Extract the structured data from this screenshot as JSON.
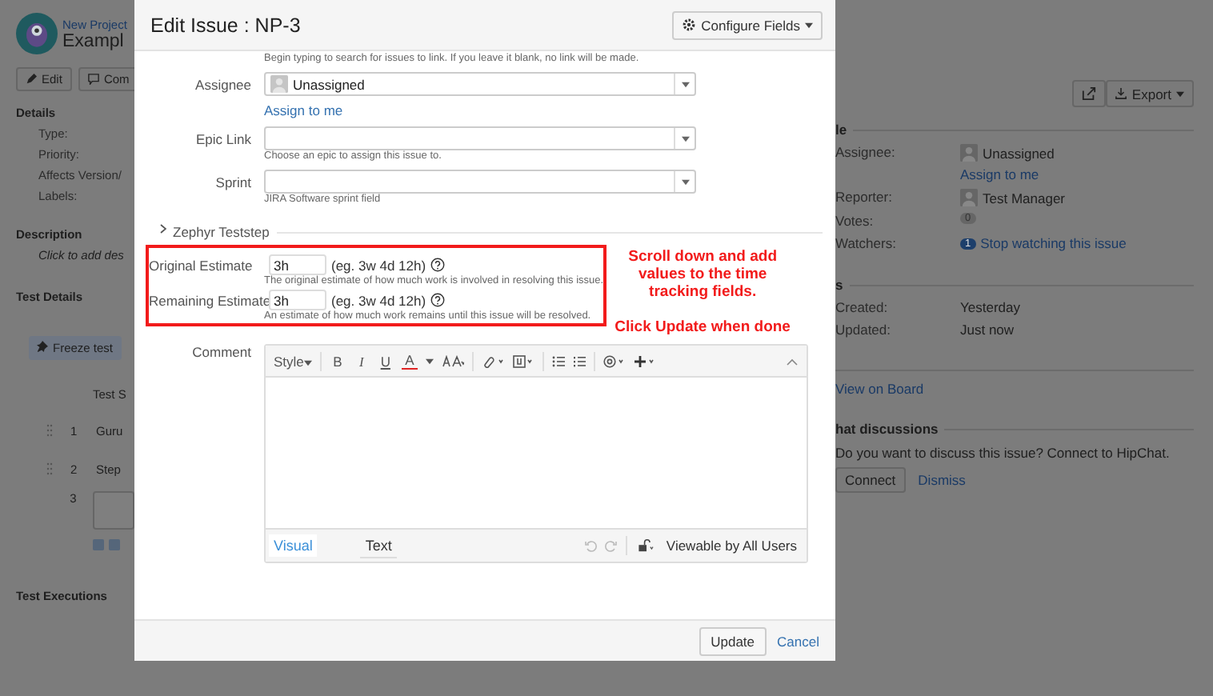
{
  "page": {
    "project": "New Project",
    "title": "Exampl",
    "actions": [
      "Edit",
      "Com"
    ],
    "details": {
      "heading": "Details",
      "fields": [
        "Type:",
        "Priority:",
        "Affects Version/",
        "Labels:"
      ]
    },
    "description": {
      "heading": "Description",
      "text": "Click to add des"
    },
    "test_details": {
      "heading": "Test Details",
      "freeze_button": "Freeze test",
      "column": "Test S",
      "steps": [
        {
          "kind": "text",
          "number": "1",
          "text": "Guru"
        },
        {
          "kind": "text",
          "number": "2",
          "text": "Step"
        },
        {
          "kind": "input",
          "number": "3"
        }
      ]
    },
    "test_executions": "Test Executions",
    "export_button": "Export",
    "people": {
      "heading": "le",
      "rows": [
        {
          "kind": "user",
          "label": "Assignee:",
          "value": "Unassigned",
          "link": "Assign to me"
        },
        {
          "kind": "user",
          "label": "Reporter:",
          "value": "Test Manager"
        },
        {
          "kind": "count",
          "label": "Votes:",
          "count": "0",
          "highlighted": false
        },
        {
          "kind": "count",
          "label": "Watchers:",
          "count": "1",
          "highlighted": true,
          "link": "Stop watching this issue"
        }
      ]
    },
    "dates": {
      "heading": "s",
      "rows": [
        {
          "label": "Created:",
          "value": "Yesterday"
        },
        {
          "label": "Updated:",
          "value": "Just now"
        }
      ]
    },
    "agile": {
      "link": "View on Board"
    },
    "hipchat": {
      "heading": "hat discussions",
      "text": "Do you want to discuss this issue? Connect to HipChat.",
      "connect_button": "Connect",
      "dismiss_link": "Dismiss"
    }
  },
  "dialog": {
    "title": "Edit Issue : NP-3",
    "configure_button": "Configure Fields",
    "top_hint": "Begin typing to search for issues to link. If you leave it blank, no link will be made.",
    "fields": [
      {
        "label": "Assignee",
        "value": "Unassigned",
        "link": "Assign to me"
      },
      {
        "label": "Epic Link",
        "hint": "Choose an epic to assign this issue to."
      },
      {
        "label": "Sprint",
        "hint": "JIRA Software sprint field"
      }
    ],
    "section": {
      "label": "Zephyr Teststep",
      "expanded": false
    },
    "time_tracking": [
      {
        "label": "Original Estimate",
        "value": "3h",
        "example": "(eg. 3w 4d 12h)",
        "hint": "The original estimate of how much work is involved in resolving this issue."
      },
      {
        "label": "Remaining Estimate",
        "value": "3h",
        "example": "(eg. 3w 4d 12h)",
        "hint": "An estimate of how much work remains until this issue will be resolved."
      }
    ],
    "annotation": [
      "Scroll down and add values to the time tracking fields.",
      "Click Update when done"
    ],
    "comment": {
      "label": "Comment",
      "style_menu": "Style",
      "format_buttons": [
        "B",
        "I",
        "U",
        "A"
      ],
      "tabs": [
        {
          "label": "Visual",
          "selected": true
        },
        {
          "label": "Text",
          "selected": false
        }
      ],
      "visibility": "Viewable by All Users"
    },
    "update_button": "Update",
    "cancel_link": "Cancel"
  }
}
